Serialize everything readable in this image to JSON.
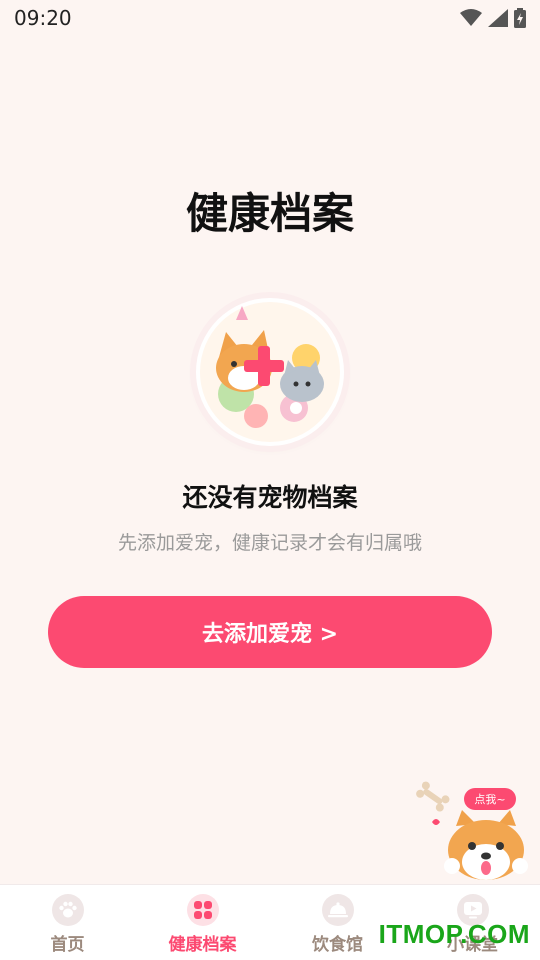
{
  "status_bar": {
    "time": "09:20",
    "icons": [
      "wifi-icon",
      "cell-signal-icon",
      "battery-charging-icon"
    ]
  },
  "header": {
    "title": "健康档案"
  },
  "empty_state": {
    "illustration": "pets-add-illustration",
    "title": "还没有宠物档案",
    "subtitle": "先添加爱宠，健康记录才会有归属哦"
  },
  "cta": {
    "label": "去添加爱宠 >"
  },
  "mascot": {
    "bubble": "点我~"
  },
  "tabs": [
    {
      "label": "首页",
      "icon": "paw-icon",
      "active": false
    },
    {
      "label": "健康档案",
      "icon": "grid-icon",
      "active": true
    },
    {
      "label": "饮食馆",
      "icon": "food-cloche-icon",
      "active": false
    },
    {
      "label": "小课堂",
      "icon": "video-play-icon",
      "active": false
    }
  ],
  "watermark": "ITMOP.COM",
  "colors": {
    "accent": "#fc4a71",
    "background": "#fdf5f2",
    "tab_inactive": "#9c8a7e"
  }
}
